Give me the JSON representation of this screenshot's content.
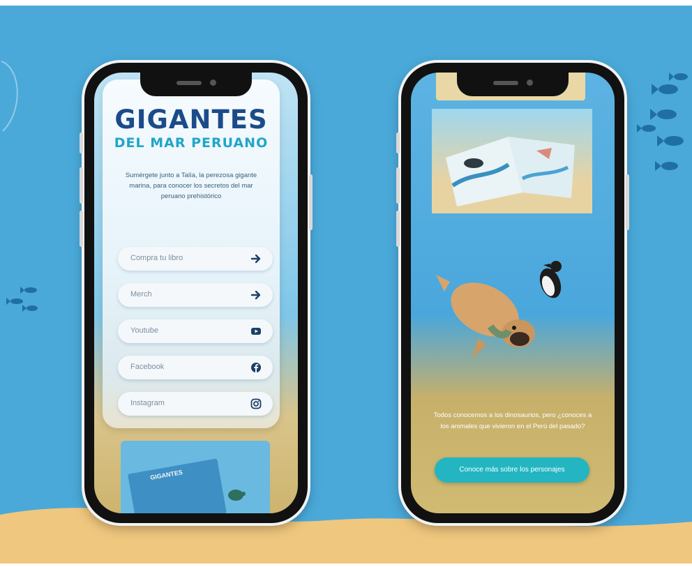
{
  "colors": {
    "ocean": "#4aa9d9",
    "sand": "#f0c77e",
    "logo_primary": "#1c4b8a",
    "logo_secondary": "#1fa6c9",
    "cta": "#23b5c2"
  },
  "left_phone": {
    "logo_title": "GIGANTES",
    "logo_subtitle": "DEL MAR PERUANO",
    "intro": "Sumérgete junto a Talía, la perezosa gigante marina, para conocer los secretos del mar peruano prehistórico",
    "links": [
      {
        "label": "Compra tu libro",
        "icon": "arrow-right-icon"
      },
      {
        "label": "Merch",
        "icon": "arrow-right-icon"
      },
      {
        "label": "Youtube",
        "icon": "youtube-icon"
      },
      {
        "label": "Facebook",
        "icon": "facebook-icon"
      },
      {
        "label": "Instagram",
        "icon": "instagram-icon"
      }
    ],
    "book_cover_title": "GIGANTES"
  },
  "right_phone": {
    "description": "Todos conocemos a los dinosaurios, pero ¿conoces a los animales que vivieron en el Perú del pasado?",
    "cta_label": "Conoce más sobre los personajes"
  }
}
